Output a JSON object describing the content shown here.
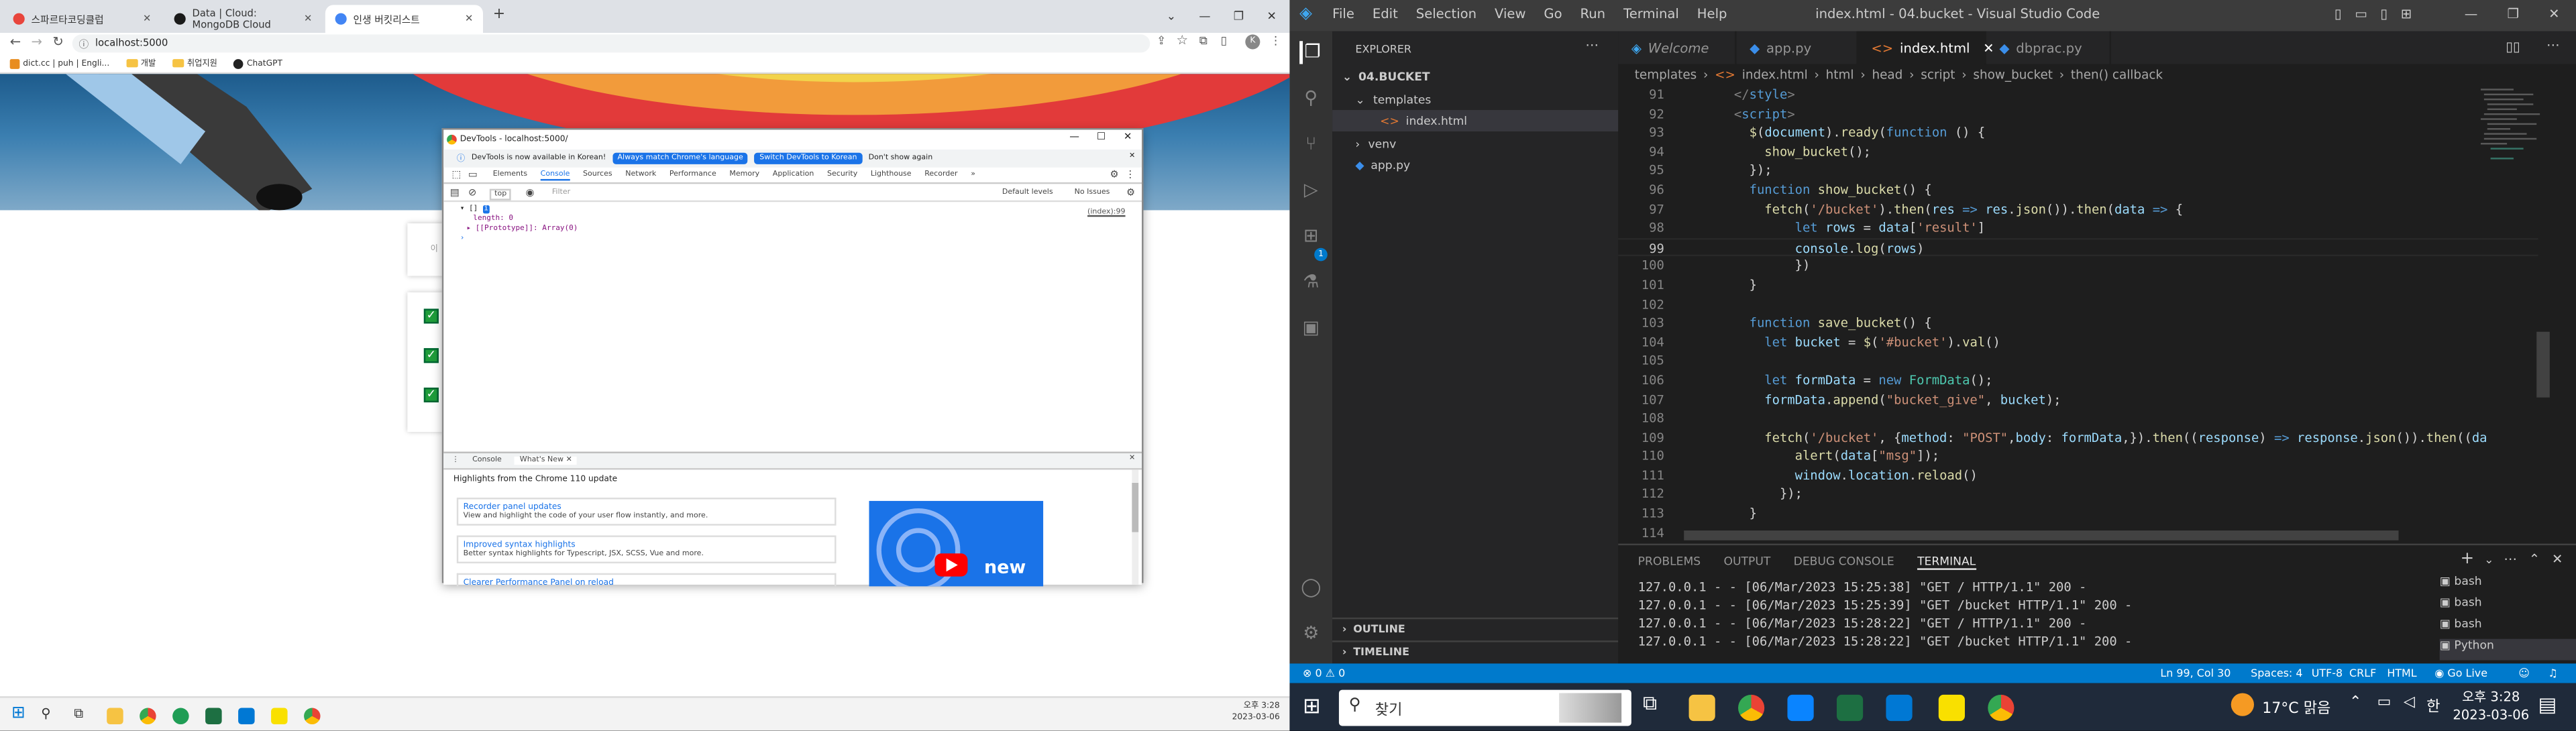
{
  "chrome": {
    "tabs": [
      {
        "label": "스파르타코딩클럽",
        "color": "#e8453c"
      },
      {
        "label": "Data | Cloud: MongoDB Cloud",
        "color": "#1a1a1a"
      },
      {
        "label": "인생 버킷리스트",
        "color": "#4285f4"
      }
    ],
    "new_tab": "+",
    "address": "localhost:5000",
    "profile_initial": "K",
    "bookmarks": [
      "dict.cc | puh | Engli...",
      "개발",
      "취업지원",
      "ChatGPT"
    ]
  },
  "devtools": {
    "window_title": "DevTools - localhost:5000/",
    "info_text": "DevTools is now available in Korean!",
    "btn_always": "Always match Chrome's language",
    "btn_switch": "Switch DevTools to Korean",
    "btn_dont": "Don't show again",
    "tabs": [
      "Elements",
      "Console",
      "Sources",
      "Network",
      "Performance",
      "Memory",
      "Application",
      "Security",
      "Lighthouse",
      "Recorder"
    ],
    "context": "top",
    "filter_placeholder": "Filter",
    "levels": "Default levels",
    "issues": "No Issues",
    "log_source": "(index):99",
    "log_array": "▾ [] ",
    "log_badge": "i",
    "log_length": "length: 0",
    "log_proto": "▸ [[Prototype]]: Array(0)",
    "prompt": "›",
    "drawer_tabs": [
      "Console",
      "What's New"
    ],
    "highlights": "Highlights from the Chrome 110 update",
    "updates": [
      {
        "title": "Recorder panel updates",
        "desc": "View and highlight the code of your user flow instantly, and more."
      },
      {
        "title": "Improved syntax highlights",
        "desc": "Better syntax highlights for Typescript, JSX, SCSS, Vue and more."
      },
      {
        "title": "Clearer Performance Panel on reload",
        "desc": ""
      }
    ],
    "video_text": "new"
  },
  "taskbar_left": {
    "time": "오후 3:28",
    "date": "2023-03-06"
  },
  "vscode": {
    "menu": [
      "File",
      "Edit",
      "Selection",
      "View",
      "Go",
      "Run",
      "Terminal",
      "Help"
    ],
    "title": "index.html - 04.bucket - Visual Studio Code",
    "explorer_label": "EXPLORER",
    "folder": "04.BUCKET",
    "tree": [
      {
        "label": "templates",
        "type": "folder-open"
      },
      {
        "label": "index.html",
        "type": "html"
      },
      {
        "label": "venv",
        "type": "folder"
      },
      {
        "label": "app.py",
        "type": "py"
      }
    ],
    "outline": "OUTLINE",
    "timeline": "TIMELINE",
    "tabs": [
      {
        "label": "Welcome",
        "icon": "vscode"
      },
      {
        "label": "app.py",
        "icon": "py"
      },
      {
        "label": "index.html",
        "icon": "html"
      },
      {
        "label": "dbprac.py",
        "icon": "py"
      }
    ],
    "breadcrumb": [
      "templates",
      "index.html",
      "html",
      "head",
      "script",
      "show_bucket",
      "then() callback"
    ],
    "code": [
      {
        "n": "91",
        "html": "    <span style=\"color:#808080\">&lt;/</span><span style=\"color:#569cd6\">style</span><span style=\"color:#808080\">&gt;</span>"
      },
      {
        "n": "92",
        "html": "    <span style=\"color:#808080\">&lt;</span><span style=\"color:#569cd6\">script</span><span style=\"color:#808080\">&gt;</span>"
      },
      {
        "n": "93",
        "html": "      <span style=\"color:#dcdcaa\">$</span>(<span style=\"color:#9cdcfe\">document</span>).<span style=\"color:#dcdcaa\">ready</span>(<span style=\"color:#569cd6\">function</span> () {"
      },
      {
        "n": "94",
        "html": "        <span style=\"color:#dcdcaa\">show_bucket</span>();"
      },
      {
        "n": "95",
        "html": "      });"
      },
      {
        "n": "96",
        "html": "      <span style=\"color:#569cd6\">function</span> <span style=\"color:#dcdcaa\">show_bucket</span>() {"
      },
      {
        "n": "97",
        "html": "        <span style=\"color:#dcdcaa\">fetch</span>(<span style=\"color:#ce9178\">'/bucket'</span>).<span style=\"color:#dcdcaa\">then</span>(<span style=\"color:#9cdcfe\">res</span> <span style=\"color:#569cd6\">=&gt;</span> <span style=\"color:#9cdcfe\">res</span>.<span style=\"color:#dcdcaa\">json</span>()).<span style=\"color:#dcdcaa\">then</span>(<span style=\"color:#9cdcfe\">data</span> <span style=\"color:#569cd6\">=&gt;</span> {"
      },
      {
        "n": "98",
        "html": "            <span style=\"color:#569cd6\">let</span> <span style=\"color:#9cdcfe\">rows</span> = <span style=\"color:#9cdcfe\">data</span>[<span style=\"color:#ce9178\">'result'</span>]"
      },
      {
        "n": "99",
        "html": "            <span style=\"color:#9cdcfe\">console</span>.<span style=\"color:#dcdcaa\">log</span>(<span style=\"color:#9cdcfe\">rows</span>)",
        "current": true
      },
      {
        "n": "100",
        "html": "            })"
      },
      {
        "n": "101",
        "html": "      }"
      },
      {
        "n": "102",
        "html": ""
      },
      {
        "n": "103",
        "html": "      <span style=\"color:#569cd6\">function</span> <span style=\"color:#dcdcaa\">save_bucket</span>() {"
      },
      {
        "n": "104",
        "html": "        <span style=\"color:#569cd6\">let</span> <span style=\"color:#9cdcfe\">bucket</span> = <span style=\"color:#dcdcaa\">$</span>(<span style=\"color:#ce9178\">'#bucket'</span>).<span style=\"color:#dcdcaa\">val</span>()"
      },
      {
        "n": "105",
        "html": ""
      },
      {
        "n": "106",
        "html": "        <span style=\"color:#569cd6\">let</span> <span style=\"color:#9cdcfe\">formData</span> = <span style=\"color:#569cd6\">new</span> <span style=\"color:#4ec9b0\">FormData</span>();"
      },
      {
        "n": "107",
        "html": "        <span style=\"color:#9cdcfe\">formData</span>.<span style=\"color:#dcdcaa\">append</span>(<span style=\"color:#ce9178\">\"bucket_give\"</span>, <span style=\"color:#9cdcfe\">bucket</span>);"
      },
      {
        "n": "108",
        "html": ""
      },
      {
        "n": "109",
        "html": "        <span style=\"color:#dcdcaa\">fetch</span>(<span style=\"color:#ce9178\">'/bucket'</span>, {<span style=\"color:#9cdcfe\">method</span>: <span style=\"color:#ce9178\">\"POST\"</span>,<span style=\"color:#9cdcfe\">body</span>: <span style=\"color:#9cdcfe\">formData</span>,}).<span style=\"color:#dcdcaa\">then</span>((<span style=\"color:#9cdcfe\">response</span>) <span style=\"color:#569cd6\">=&gt;</span> <span style=\"color:#9cdcfe\">response</span>.<span style=\"color:#dcdcaa\">json</span>()).<span style=\"color:#dcdcaa\">then</span>((<span style=\"color:#9cdcfe\">da</span>"
      },
      {
        "n": "110",
        "html": "            <span style=\"color:#dcdcaa\">alert</span>(<span style=\"color:#9cdcfe\">data</span>[<span style=\"color:#ce9178\">\"msg\"</span>]);"
      },
      {
        "n": "111",
        "html": "            <span style=\"color:#9cdcfe\">window</span>.<span style=\"color:#9cdcfe\">location</span>.<span style=\"color:#dcdcaa\">reload</span>()"
      },
      {
        "n": "112",
        "html": "          });"
      },
      {
        "n": "113",
        "html": "      }"
      },
      {
        "n": "114",
        "html": ""
      }
    ],
    "panel_tabs": [
      "PROBLEMS",
      "OUTPUT",
      "DEBUG CONSOLE",
      "TERMINAL"
    ],
    "terminal": [
      "127.0.0.1 - - [06/Mar/2023 15:25:38] \"GET / HTTP/1.1\" 200 -",
      "127.0.0.1 - - [06/Mar/2023 15:25:39] \"GET /bucket HTTP/1.1\" 200 -",
      "127.0.0.1 - - [06/Mar/2023 15:28:22] \"GET / HTTP/1.1\" 200 -",
      "127.0.0.1 - - [06/Mar/2023 15:28:22] \"GET /bucket HTTP/1.1\" 200 -"
    ],
    "terminals": [
      "bash",
      "bash",
      "bash",
      "Python"
    ],
    "status": {
      "errors": "0",
      "warnings": "0",
      "position": "Ln 99, Col 30",
      "spaces": "Spaces: 4",
      "encoding": "UTF-8",
      "eol": "CRLF",
      "lang": "HTML",
      "golive": "Go Live"
    },
    "badge_count": "1"
  },
  "taskbar_right": {
    "search_placeholder": "찾기",
    "weather": "17°C 맑음",
    "ime": "한",
    "time": "오후 3:28",
    "date": "2023-03-06"
  },
  "colors": {
    "vscode_accent": "#007acc",
    "devtools_blue": "#1a73e8",
    "check_green": "#1f9d3a"
  }
}
